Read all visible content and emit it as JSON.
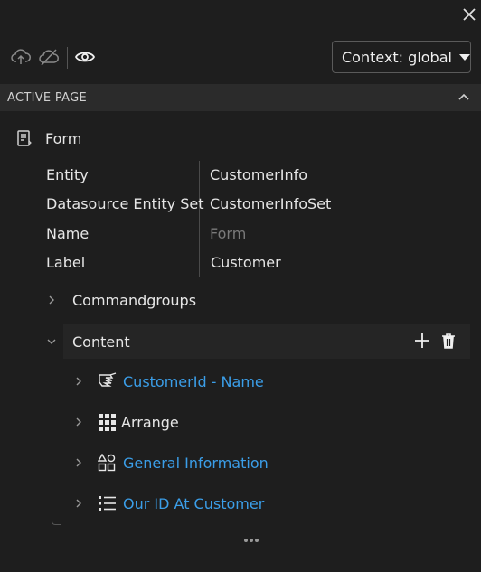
{
  "context": {
    "label": "Context: global"
  },
  "section": {
    "title": "ACTIVE PAGE"
  },
  "form": {
    "title": "Form",
    "properties": [
      {
        "key": "Entity",
        "value": "CustomerInfo"
      },
      {
        "key": "Datasource Entity Set",
        "value": "CustomerInfoSet"
      },
      {
        "key": "Name",
        "value": "Form"
      },
      {
        "key": "Label",
        "value": "Customer"
      }
    ]
  },
  "tree": {
    "commandgroups": "Commandgroups",
    "content": "Content",
    "children": [
      {
        "label": "CustomerId - Name",
        "icon": "field-hand-icon",
        "link": true
      },
      {
        "label": "Arrange",
        "icon": "grid-icon",
        "link": false
      },
      {
        "label": "General Information",
        "icon": "shapes-group-icon",
        "link": true
      },
      {
        "label": "Our ID At Customer",
        "icon": "list-icon",
        "link": true
      }
    ]
  },
  "colors": {
    "link": "#3b9ee8",
    "background": "#1e1e1e",
    "header": "#2b2b2b"
  }
}
